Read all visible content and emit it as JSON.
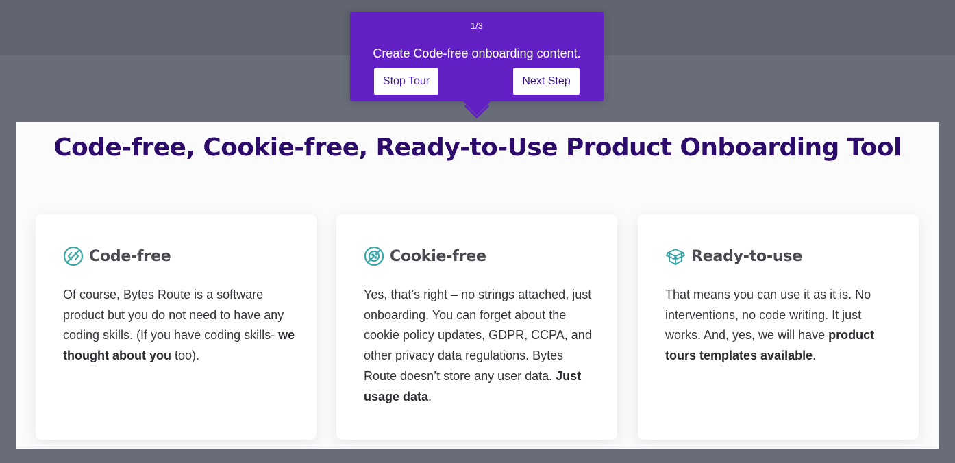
{
  "tour": {
    "step": "1/3",
    "text": "Create Code-free onboarding content.",
    "stop_label": "Stop Tour",
    "next_label": "Next Step",
    "color": "#621fc4"
  },
  "headline": "Code-free, Cookie-free, Ready-to-Use Product Onboarding Tool",
  "cards": [
    {
      "icon": "code-free-icon",
      "title": "Code-free",
      "body": [
        {
          "text": "Of course, Bytes Route is a software product but you do not need to have any coding skills. (If you have coding skills- "
        },
        {
          "text": "we thought about you",
          "bold": true
        },
        {
          "text": " too)."
        }
      ]
    },
    {
      "icon": "cookie-free-icon",
      "title": "Cookie-free",
      "body": [
        {
          "text": "Yes, that’s right – no strings attached, just onboarding. You can forget about the cookie policy updates, GDPR, CCPA, and other privacy data regulations. Bytes Route doesn’t store any user data. "
        },
        {
          "text": "Just usage data",
          "bold": true
        },
        {
          "text": "."
        }
      ]
    },
    {
      "icon": "box-icon",
      "title": "Ready-to-use",
      "body": [
        {
          "text": "That means you can use it as it is. No interventions, no code writing. It just works. And, yes, we will have "
        },
        {
          "text": "product tours templates available",
          "bold": true
        },
        {
          "text": "."
        }
      ]
    }
  ],
  "colors": {
    "headline": "#2c0b6b",
    "icon_teal": "#3aa6a6",
    "overlay": "#696d77"
  }
}
